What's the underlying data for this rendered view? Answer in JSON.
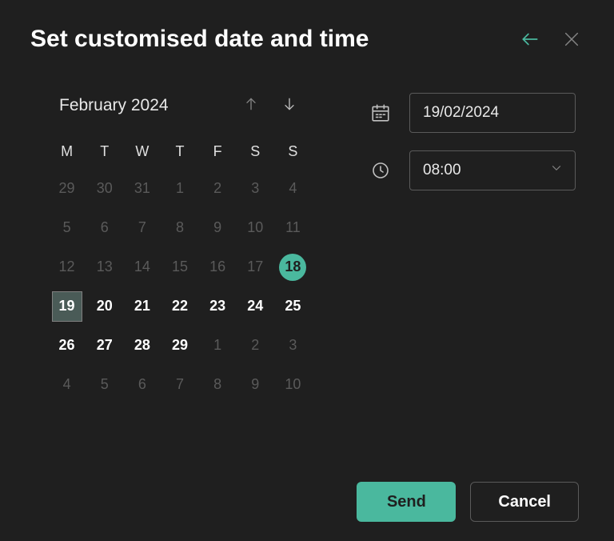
{
  "title": "Set customised date and time",
  "calendar": {
    "month_label": "February 2024",
    "dow": [
      "M",
      "T",
      "W",
      "T",
      "F",
      "S",
      "S"
    ],
    "today": 18,
    "selected": 19,
    "weeks": [
      [
        {
          "n": 29,
          "out": true
        },
        {
          "n": 30,
          "out": true
        },
        {
          "n": 31,
          "out": true
        },
        {
          "n": 1,
          "out": true
        },
        {
          "n": 2,
          "out": true
        },
        {
          "n": 3,
          "out": true
        },
        {
          "n": 4,
          "out": true
        }
      ],
      [
        {
          "n": 5,
          "out": true
        },
        {
          "n": 6,
          "out": true
        },
        {
          "n": 7,
          "out": true
        },
        {
          "n": 8,
          "out": true
        },
        {
          "n": 9,
          "out": true
        },
        {
          "n": 10,
          "out": true
        },
        {
          "n": 11,
          "out": true
        }
      ],
      [
        {
          "n": 12,
          "out": true
        },
        {
          "n": 13,
          "out": true
        },
        {
          "n": 14,
          "out": true
        },
        {
          "n": 15,
          "out": true
        },
        {
          "n": 16,
          "out": true
        },
        {
          "n": 17,
          "out": true
        },
        {
          "n": 18,
          "out": false
        }
      ],
      [
        {
          "n": 19,
          "out": false
        },
        {
          "n": 20,
          "out": false
        },
        {
          "n": 21,
          "out": false
        },
        {
          "n": 22,
          "out": false
        },
        {
          "n": 23,
          "out": false
        },
        {
          "n": 24,
          "out": false
        },
        {
          "n": 25,
          "out": false
        }
      ],
      [
        {
          "n": 26,
          "out": false
        },
        {
          "n": 27,
          "out": false
        },
        {
          "n": 28,
          "out": false
        },
        {
          "n": 29,
          "out": false
        },
        {
          "n": 1,
          "out": true
        },
        {
          "n": 2,
          "out": true
        },
        {
          "n": 3,
          "out": true
        }
      ],
      [
        {
          "n": 4,
          "out": true
        },
        {
          "n": 5,
          "out": true
        },
        {
          "n": 6,
          "out": true
        },
        {
          "n": 7,
          "out": true
        },
        {
          "n": 8,
          "out": true
        },
        {
          "n": 9,
          "out": true
        },
        {
          "n": 10,
          "out": true
        }
      ]
    ]
  },
  "date_field": "19/02/2024",
  "time_field": "08:00",
  "buttons": {
    "send": "Send",
    "cancel": "Cancel"
  }
}
